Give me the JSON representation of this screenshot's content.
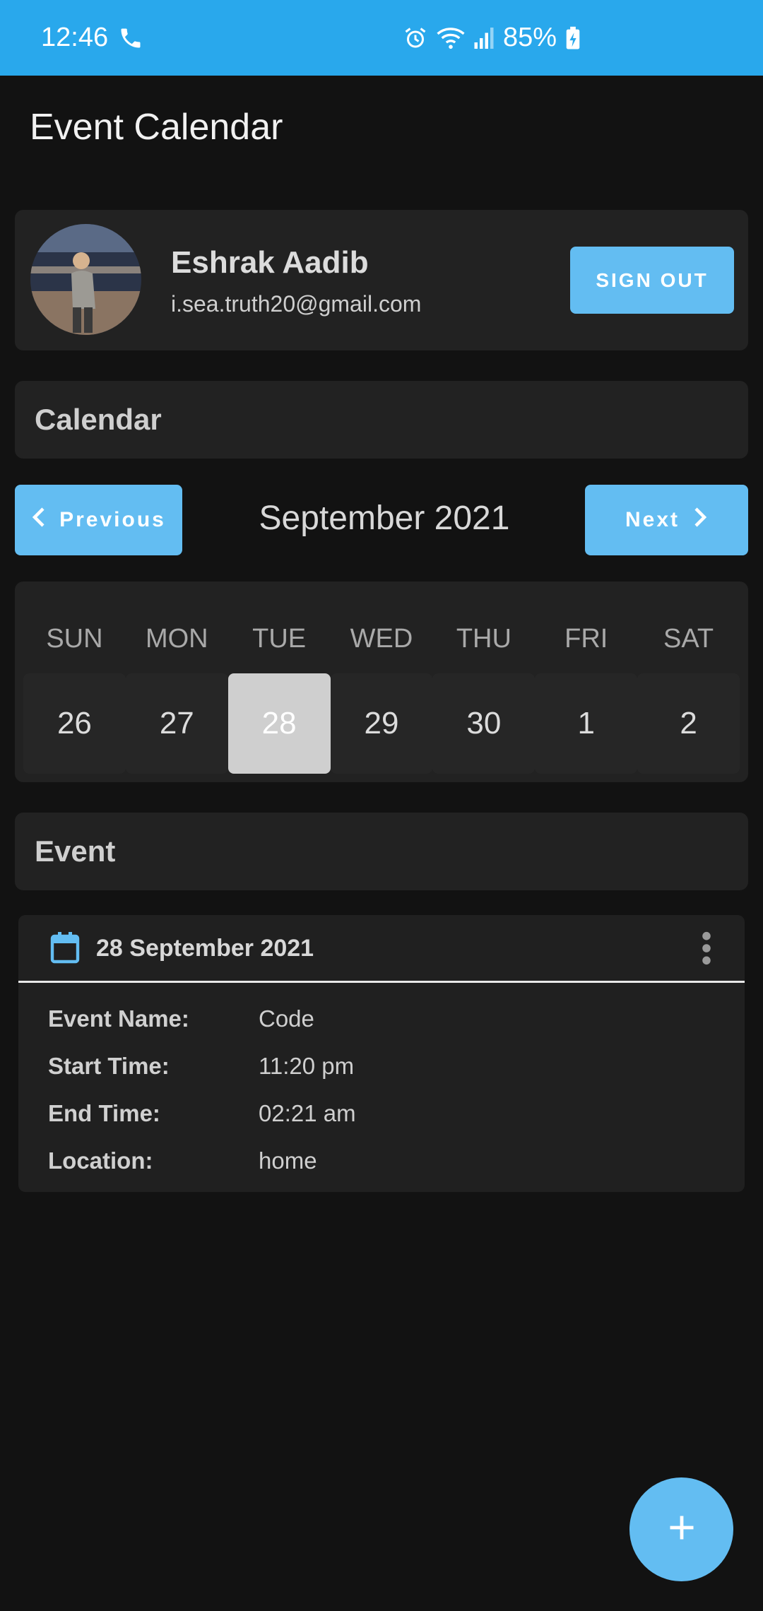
{
  "status_bar": {
    "time": "12:46",
    "battery": "85%",
    "color": "#29a8ec"
  },
  "app": {
    "title": "Event Calendar"
  },
  "profile": {
    "name": "Eshrak Aadib",
    "email": "i.sea.truth20@gmail.com",
    "sign_out_label": "SIGN OUT"
  },
  "calendar": {
    "section_title": "Calendar",
    "prev_label": "Previous",
    "next_label": "Next",
    "month_label": "September 2021",
    "days_of_week": [
      "SUN",
      "MON",
      "TUE",
      "WED",
      "THU",
      "FRI",
      "SAT"
    ],
    "days": [
      "26",
      "27",
      "28",
      "29",
      "30",
      "1",
      "2"
    ],
    "selected_day": "28"
  },
  "event": {
    "section_title": "Event",
    "date": "28 September 2021",
    "fields": [
      {
        "label": "Event Name:",
        "value": "Code"
      },
      {
        "label": "Start Time:",
        "value": "11:20 pm"
      },
      {
        "label": "End Time:",
        "value": "02:21 am"
      },
      {
        "label": "Location:",
        "value": "home"
      }
    ]
  },
  "colors": {
    "accent": "#63bdf2",
    "background": "#121212",
    "card": "#222222"
  },
  "icons": {
    "status_left": [
      "phone-icon"
    ],
    "status_right": [
      "alarm-icon",
      "wifi-icon",
      "signal-icon",
      "battery-icon"
    ],
    "event": [
      "calendar-icon",
      "more-vert-icon"
    ],
    "fab": "add-icon"
  }
}
